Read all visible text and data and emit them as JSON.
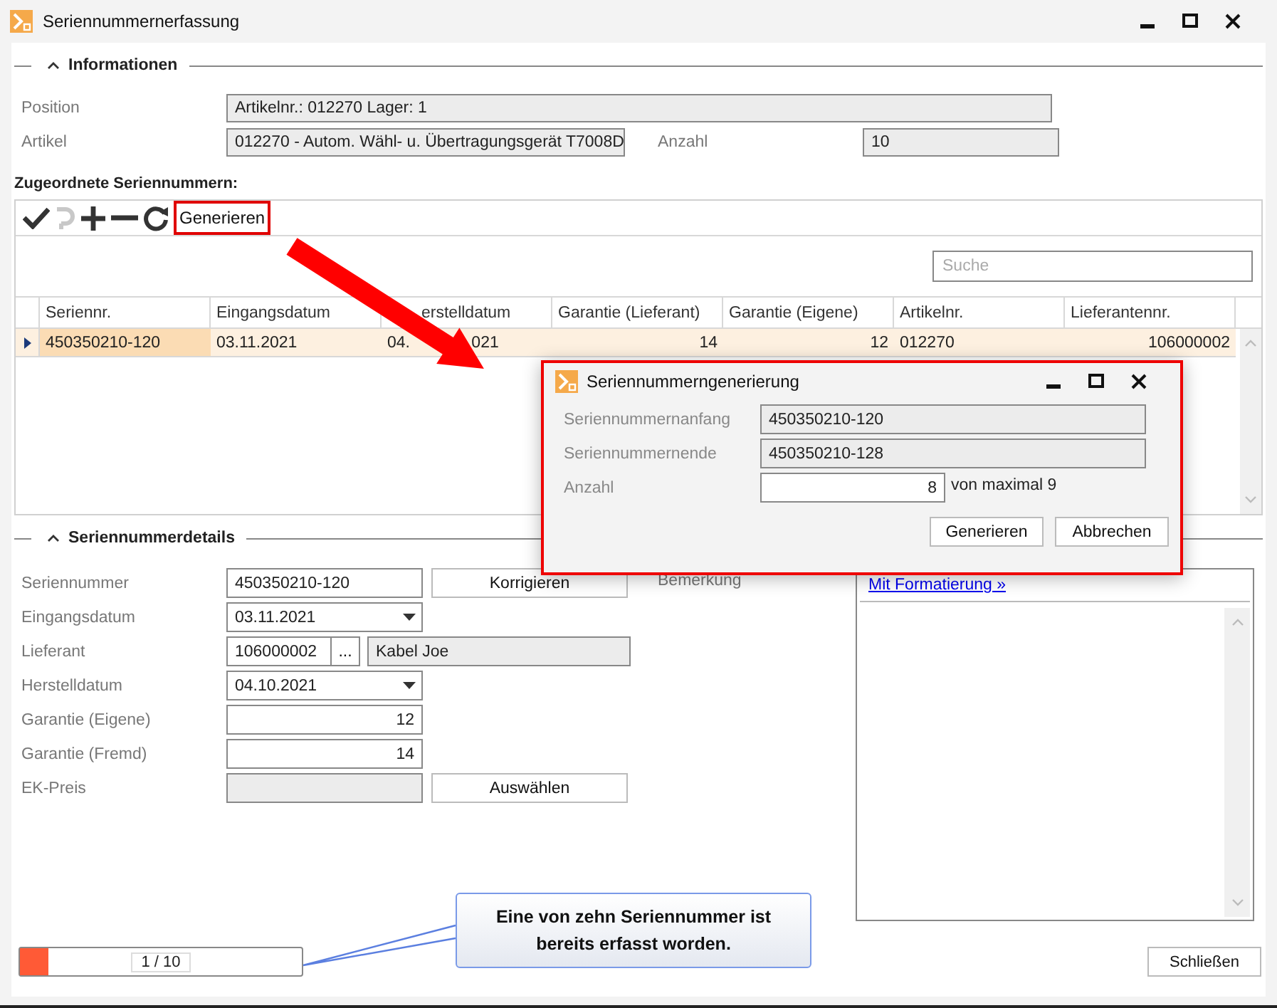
{
  "window": {
    "title": "Seriennummernerfassung"
  },
  "info": {
    "title": "Informationen",
    "expanded": true,
    "position": {
      "label": "Position",
      "value": "Artikelnr.: 012270 Lager: 1"
    },
    "article": {
      "label": "Artikel",
      "value": "012270 - Autom. Wähl- u. Übertragungsgerät T7008D"
    },
    "quantity": {
      "label": "Anzahl",
      "value": "10"
    }
  },
  "assigned": {
    "title": "Zugeordnete Seriennummern:",
    "toolbar": [
      {
        "kind": "check",
        "disabled": false
      },
      {
        "kind": "undo",
        "disabled": true
      },
      {
        "kind": "add",
        "disabled": false
      },
      {
        "kind": "remove",
        "disabled": false
      },
      {
        "kind": "refresh",
        "disabled": false
      }
    ],
    "generate_button": {
      "label": "Generieren",
      "highlighted": true
    },
    "search": {
      "placeholder": "Suche"
    },
    "columns": [
      {
        "label": "Seriennr.",
        "kind": "text"
      },
      {
        "label": "Eingangsdatum",
        "kind": "text"
      },
      {
        "label": "erstelldatum",
        "kind": "obscured"
      },
      {
        "label": "Garantie (Lieferant)",
        "kind": "number"
      },
      {
        "label": "Garantie (Eigene)",
        "kind": "number"
      },
      {
        "label": "Artikelnr.",
        "kind": "text"
      },
      {
        "label": "Lieferantennr.",
        "kind": "number"
      }
    ],
    "rows": [
      {
        "selected": true,
        "cells": [
          "450350210-120",
          "03.11.2021",
          "04. 021",
          "14",
          "12",
          "012270",
          "106000002"
        ]
      }
    ]
  },
  "details": {
    "title": "Seriennummerdetails",
    "expanded": true,
    "fields": [
      {
        "kind": "text",
        "label": "Seriennummer",
        "value": "450350210-120",
        "button": "Korrigieren"
      },
      {
        "kind": "date",
        "label": "Eingangsdatum",
        "value": "03.11.2021"
      },
      {
        "kind": "lookup",
        "label": "Lieferant",
        "value": "106000002",
        "browse": "...",
        "name": "Kabel Joe"
      },
      {
        "kind": "date",
        "label": "Herstelldatum",
        "value": "04.10.2021"
      },
      {
        "kind": "number",
        "label": "Garantie (Eigene)",
        "value": "12"
      },
      {
        "kind": "number",
        "label": "Garantie (Fremd)",
        "value": "14"
      },
      {
        "kind": "readonly",
        "label": "EK-Preis",
        "button": "Auswählen"
      }
    ],
    "remark": {
      "label": "Bemerkung",
      "link": "Mit Formatierung »"
    }
  },
  "progress": {
    "level": 0.1,
    "label": "1 / 10"
  },
  "callout": "Eine von zehn Seriennummer ist bereits erfasst worden.",
  "close_button": "Schließen",
  "dialog": {
    "title": "Seriennummerngenerierung",
    "highlighted": true,
    "start": {
      "label": "Seriennummernanfang",
      "value": "450350210-120"
    },
    "end": {
      "label": "Seriennummernende",
      "value": "450350210-128"
    },
    "count": {
      "label": "Anzahl",
      "value": "8",
      "hint": "von maximal 9"
    },
    "buttons": [
      "Generieren",
      "Abbrechen"
    ]
  }
}
